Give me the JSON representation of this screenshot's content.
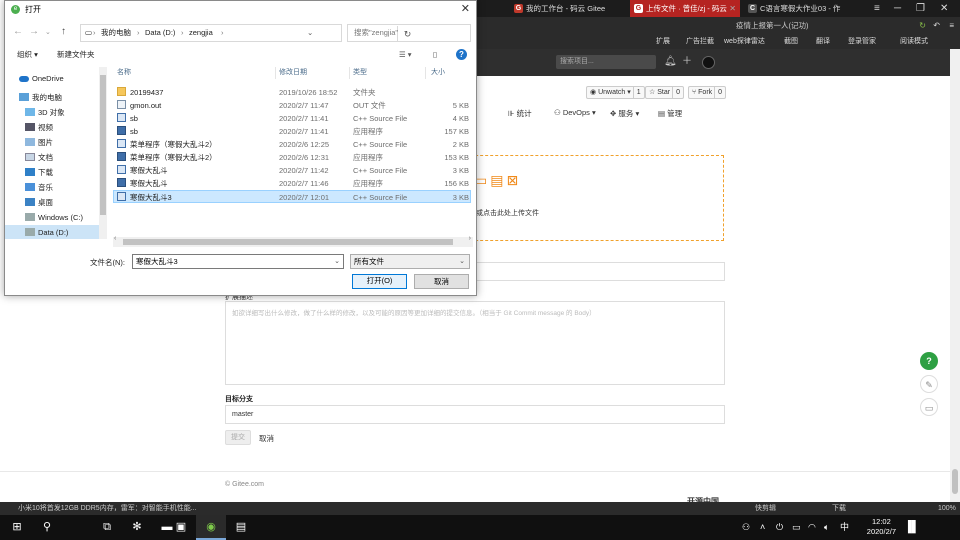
{
  "browser": {
    "tabs": [
      {
        "label": "我的工作台 - 码云 Gitee",
        "active": false
      },
      {
        "label": "上传文件 · 曾佳/zj - 码云",
        "active": true
      },
      {
        "label": "C语言寒假大作业03 - 作",
        "active": false
      }
    ],
    "addr_hint": "疫情上报第一人(记功)",
    "bookmarks": [
      "扩展",
      "广告拦截",
      "web探律雷达",
      "截图",
      "翻译",
      "登录管家",
      "阅读模式"
    ],
    "status_left": "小米10将首发12GB DDR5内存，雷军：对智能手机性能...",
    "status_right": [
      "快剪辑",
      "下载",
      "100%"
    ]
  },
  "gitee": {
    "search_placeholder": "搜索项目...",
    "watch_label": "Unwatch",
    "watch_count": "1",
    "star_label": "Star",
    "star_count": "0",
    "fork_label": "Fork",
    "fork_count": "0",
    "tabs": [
      "统计",
      "DevOps",
      "服务",
      "管理"
    ],
    "upload_hint": "或点击此处上传文件",
    "desc_label": "扩展描述",
    "desc_placeholder": "如欲详细写出什么修改，做了什么样的修改，以及可能的原因等更加详细的提交信息。（相当于 Git Commit message 的 Body）",
    "branch_label": "目标分支",
    "branch_value": "master",
    "submit_label": "提交",
    "cancel_label": "取消",
    "footer_copy": "© Gitee.com",
    "footer_brand": "开源中国"
  },
  "taskbar": {
    "time": "12:02",
    "date": "2020/2/7",
    "ime": "中"
  },
  "dialog": {
    "title": "打开",
    "breadcrumb": [
      "我的电脑",
      "Data (D:)",
      "zengjia"
    ],
    "search_placeholder": "搜索\"zengjia\"",
    "organize_label": "组织",
    "new_folder_label": "新建文件夹",
    "sidebar": [
      {
        "label": "OneDrive",
        "icon": "cloud-icon",
        "selected": false
      },
      {
        "label": "我的电脑",
        "icon": "computer-icon",
        "selected": false
      },
      {
        "label": "3D 对象",
        "icon": "cube-icon",
        "selected": false
      },
      {
        "label": "视频",
        "icon": "video-icon",
        "selected": false
      },
      {
        "label": "图片",
        "icon": "picture-icon",
        "selected": false
      },
      {
        "label": "文档",
        "icon": "document-icon",
        "selected": false
      },
      {
        "label": "下载",
        "icon": "download-icon",
        "selected": false
      },
      {
        "label": "音乐",
        "icon": "music-icon",
        "selected": false
      },
      {
        "label": "桌面",
        "icon": "desktop-icon",
        "selected": false
      },
      {
        "label": "Windows (C:)",
        "icon": "drive-icon",
        "selected": false
      },
      {
        "label": "Data (D:)",
        "icon": "drive-icon",
        "selected": true
      }
    ],
    "columns": [
      "名称",
      "修改日期",
      "类型",
      "大小"
    ],
    "files": [
      {
        "name": "20199437",
        "date": "2019/10/26 18:52",
        "type": "文件夹",
        "size": "",
        "icon": "folder"
      },
      {
        "name": "gmon.out",
        "date": "2020/2/7 11:47",
        "type": "OUT 文件",
        "size": "5 KB",
        "icon": "file"
      },
      {
        "name": "sb",
        "date": "2020/2/7 11:41",
        "type": "C++ Source File",
        "size": "4 KB",
        "icon": "cpp"
      },
      {
        "name": "sb",
        "date": "2020/2/7 11:41",
        "type": "应用程序",
        "size": "157 KB",
        "icon": "exe"
      },
      {
        "name": "菜单程序（寒假大乱斗2）",
        "date": "2020/2/6 12:25",
        "type": "C++ Source File",
        "size": "2 KB",
        "icon": "cpp"
      },
      {
        "name": "菜单程序（寒假大乱斗2）",
        "date": "2020/2/6 12:31",
        "type": "应用程序",
        "size": "153 KB",
        "icon": "exe"
      },
      {
        "name": "寒假大乱斗",
        "date": "2020/2/7 11:42",
        "type": "C++ Source File",
        "size": "3 KB",
        "icon": "cpp"
      },
      {
        "name": "寒假大乱斗",
        "date": "2020/2/7 11:46",
        "type": "应用程序",
        "size": "156 KB",
        "icon": "exe"
      },
      {
        "name": "寒假大乱斗3",
        "date": "2020/2/7 12:01",
        "type": "C++ Source File",
        "size": "3 KB",
        "icon": "cpp",
        "selected": true
      }
    ],
    "filename_label": "文件名(N):",
    "filename_value": "寒假大乱斗3",
    "filetype_value": "所有文件",
    "open_label": "打开(O)",
    "cancel_label": "取消"
  }
}
